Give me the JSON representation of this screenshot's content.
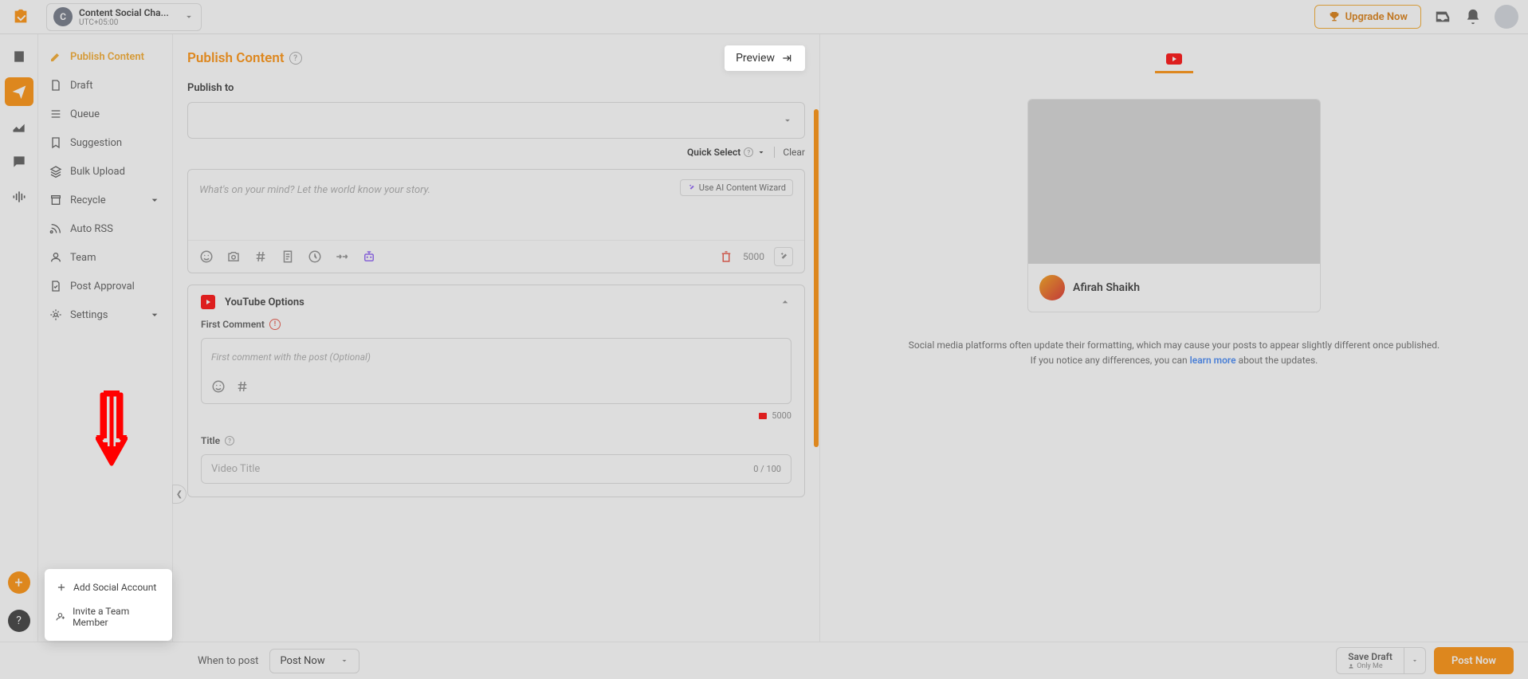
{
  "header": {
    "workspace_badge": "C",
    "workspace_name": "Content Social Cha...",
    "workspace_tz": "UTC+05:00",
    "upgrade": "Upgrade Now"
  },
  "sidebar": {
    "items": [
      {
        "label": "Publish Content"
      },
      {
        "label": "Draft"
      },
      {
        "label": "Queue"
      },
      {
        "label": "Suggestion"
      },
      {
        "label": "Bulk Upload"
      },
      {
        "label": "Recycle"
      },
      {
        "label": "Auto RSS"
      },
      {
        "label": "Team"
      },
      {
        "label": "Post Approval"
      },
      {
        "label": "Settings"
      }
    ]
  },
  "editor": {
    "title": "Publish Content",
    "preview_link": "Preview",
    "publish_to_label": "Publish to",
    "quick_select": "Quick Select",
    "clear": "Clear",
    "composer_placeholder": "What's on your mind? Let the world know your story.",
    "ai_wizard": "Use AI Content Wizard",
    "char_limit": "5000",
    "youtube": {
      "header": "YouTube Options",
      "first_comment_label": "First Comment",
      "first_comment_placeholder": "First comment with the post (Optional)",
      "comment_limit": "5000",
      "title_label": "Title",
      "title_placeholder": "Video Title",
      "title_count": "0 / 100"
    }
  },
  "preview": {
    "author": "Afirah Shaikh",
    "note1": "Social media platforms often update their formatting, which may cause your posts to appear slightly different once published.",
    "note2_a": "If you notice any differences, you can ",
    "note2_link": "learn more",
    "note2_b": " about the updates."
  },
  "footer": {
    "when_label": "When to post",
    "when_value": "Post Now",
    "save_draft": "Save Draft",
    "save_draft_sub": "Only Me",
    "post_now": "Post Now"
  },
  "popup": {
    "add_social": "Add Social Account",
    "invite_team": "Invite a Team Member"
  }
}
